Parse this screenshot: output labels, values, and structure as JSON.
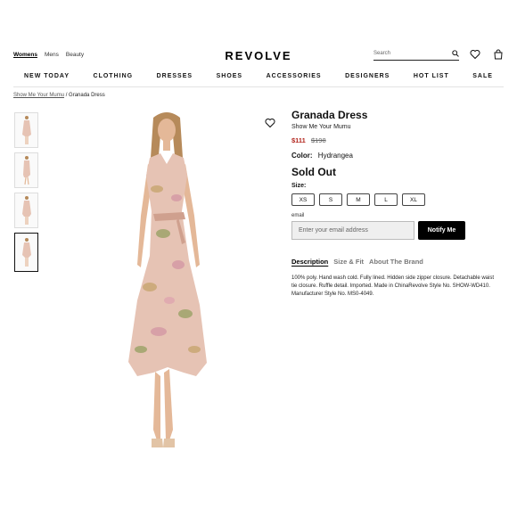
{
  "header": {
    "departments": [
      "Womens",
      "Mens",
      "Beauty"
    ],
    "active_department": "Womens",
    "logo": "REVOLVE",
    "search_placeholder": "Search",
    "icons": [
      "search-icon",
      "heart-icon",
      "bag-icon"
    ]
  },
  "nav": [
    "NEW TODAY",
    "CLOTHING",
    "DRESSES",
    "SHOES",
    "ACCESSORIES",
    "DESIGNERS",
    "HOT LIST",
    "SALE"
  ],
  "breadcrumb": {
    "brand": "Show Me Your Mumu",
    "separator": "/",
    "current": "Granada Dress"
  },
  "product": {
    "title": "Granada Dress",
    "brand": "Show Me Your Mumu",
    "sale_price": "$111",
    "original_price": "$198",
    "color_label": "Color:",
    "color_value": "Hydrangea",
    "status": "Sold Out",
    "size_label": "Size:",
    "sizes": [
      "XS",
      "S",
      "M",
      "L",
      "XL"
    ],
    "email_label": "email",
    "email_placeholder": "Enter your email address",
    "notify_label": "Notify Me",
    "tabs": [
      "Description",
      "Size & Fit",
      "About The Brand"
    ],
    "active_tab": "Description",
    "description": "100% poly. Hand wash cold. Fully lined. Hidden side zipper closure. Detachable waist tie closure. Ruffle detail. Imported. Made in ChinaRevolve Style No. SHOW-WD410. Manufacturer Style No. MS0-4049."
  },
  "colors": {
    "sale": "#b3261e",
    "dress": "#e6c3b4",
    "skin": "#e4b898",
    "hair": "#b68a5a"
  },
  "thumbnail_count": 4,
  "selected_thumbnail": 4
}
